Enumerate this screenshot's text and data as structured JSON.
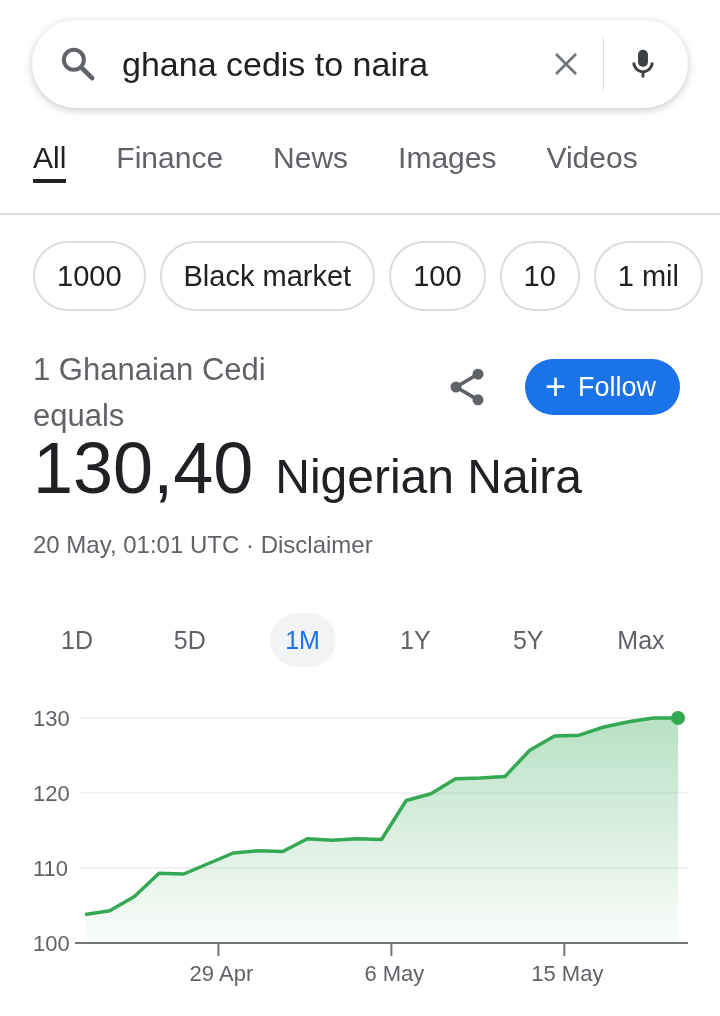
{
  "search": {
    "query": "ghana cedis to naira"
  },
  "tabs": [
    {
      "label": "All",
      "selected": true
    },
    {
      "label": "Finance",
      "selected": false
    },
    {
      "label": "News",
      "selected": false
    },
    {
      "label": "Images",
      "selected": false
    },
    {
      "label": "Videos",
      "selected": false
    }
  ],
  "chips": [
    "1000",
    "Black market",
    "100",
    "10",
    "1 mil"
  ],
  "converter": {
    "base": "1 Ghanaian Cedi equals",
    "value": "130,40",
    "currency": "Nigerian Naira",
    "timestamp": "20 May, 01:01 UTC ·",
    "disclaimer": "Disclaimer",
    "follow_icon": "+",
    "follow": "Follow"
  },
  "ranges": [
    {
      "label": "1D",
      "selected": false
    },
    {
      "label": "5D",
      "selected": false
    },
    {
      "label": "1M",
      "selected": true
    },
    {
      "label": "1Y",
      "selected": false
    },
    {
      "label": "5Y",
      "selected": false
    },
    {
      "label": "Max",
      "selected": false
    }
  ],
  "chart": {
    "chart_data": {
      "type": "area",
      "categories": [
        null,
        null,
        null,
        null,
        null,
        "29 Apr",
        null,
        null,
        null,
        null,
        null,
        null,
        "6 May",
        null,
        null,
        null,
        null,
        null,
        null,
        "15 May",
        null,
        null,
        null,
        null,
        null
      ],
      "series": [
        {
          "color": "#34a853",
          "values": [
            103.8,
            104.3,
            106.2,
            109.3,
            109.2,
            110.6,
            112.0,
            112.3,
            112.2,
            113.9,
            113.7,
            113.9,
            113.8,
            119.0,
            119.9,
            121.9,
            122.0,
            122.2,
            125.7,
            127.6,
            127.7,
            128.8,
            129.5,
            130.0,
            130.0
          ]
        }
      ],
      "ylim": [
        100,
        130
      ],
      "grid": true,
      "yticks": [
        100,
        110,
        120,
        130
      ]
    }
  }
}
